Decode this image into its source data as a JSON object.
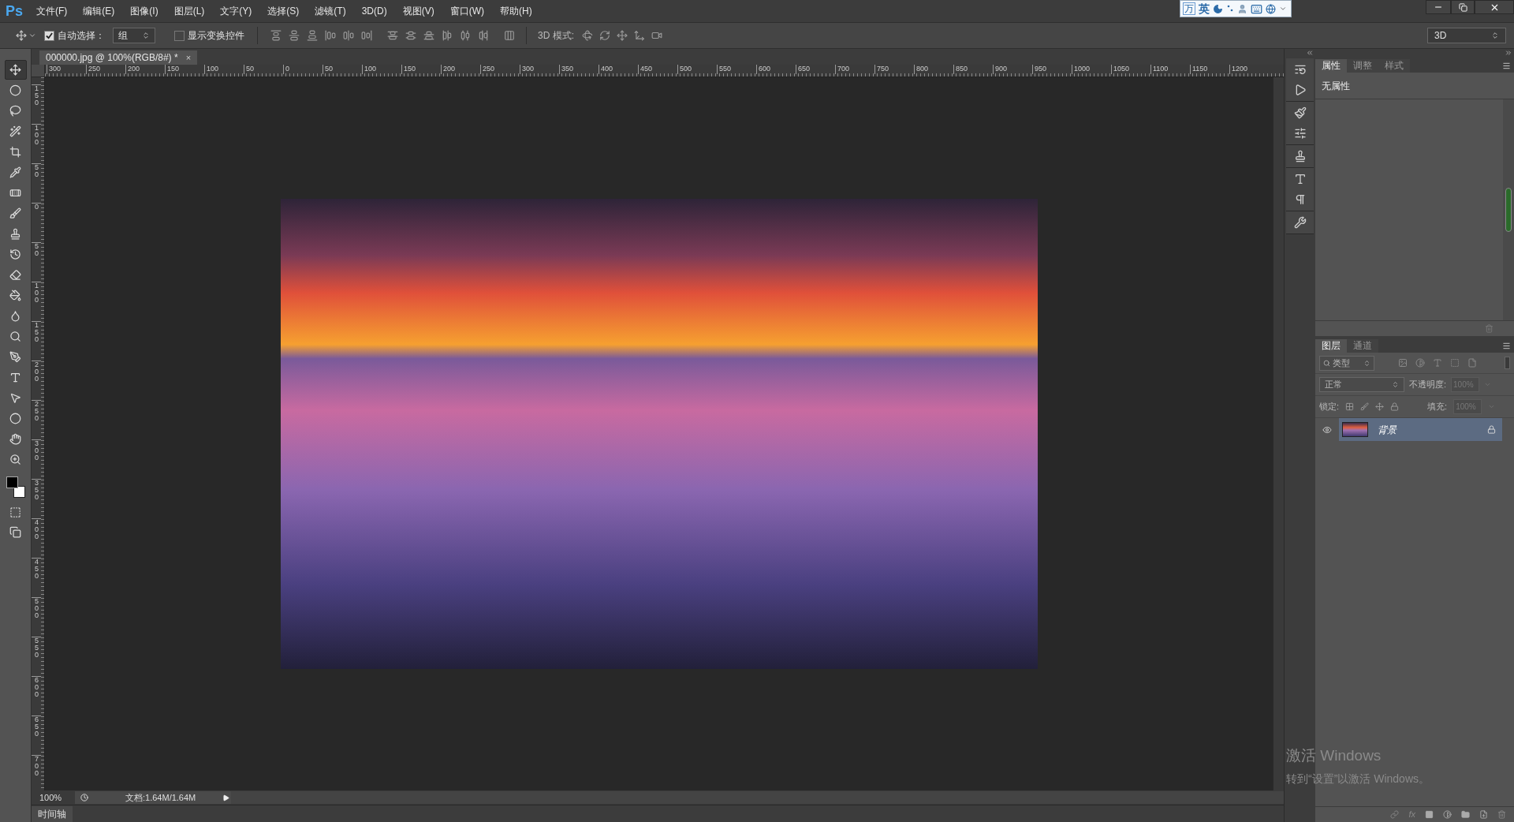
{
  "menu_bar": {
    "logo": "Ps",
    "items": [
      "文件(F)",
      "编辑(E)",
      "图像(I)",
      "图层(L)",
      "文字(Y)",
      "选择(S)",
      "滤镜(T)",
      "3D(D)",
      "视图(V)",
      "窗口(W)",
      "帮助(H)"
    ]
  },
  "ime_toolbar": {
    "logo": "万",
    "mode": "英"
  },
  "options_bar": {
    "auto_select": {
      "label": "自动选择：",
      "checked": true
    },
    "auto_select_target": "组",
    "show_transform": {
      "label": "显示变换控件",
      "checked": false
    },
    "mode_label": "3D 模式:",
    "workspace": "3D"
  },
  "tools": [
    {
      "selected": true
    },
    {
      "selected": false
    },
    {
      "selected": false
    },
    {
      "selected": false
    },
    {
      "selected": false
    },
    {
      "selected": false
    },
    {
      "selected": false
    },
    {
      "selected": false
    },
    {
      "selected": false
    },
    {
      "selected": false
    },
    {
      "selected": false
    },
    {
      "selected": false
    },
    {
      "selected": false
    },
    {
      "selected": false
    },
    {
      "selected": false
    },
    {
      "selected": false
    },
    {
      "selected": false
    },
    {
      "selected": false
    },
    {
      "selected": false
    },
    {
      "selected": false
    }
  ],
  "document_tab": {
    "title": "000000.jpg @ 100%(RGB/8#) *",
    "close": "×"
  },
  "rulers": {
    "horizontal": [
      "300",
      "250",
      "200",
      "150",
      "100",
      "50",
      "0",
      "50",
      "100",
      "150",
      "200",
      "250",
      "300",
      "350",
      "400",
      "450",
      "500",
      "550",
      "600",
      "650",
      "700",
      "750",
      "800",
      "850",
      "900",
      "950",
      "1000",
      "1050",
      "1100",
      "1150",
      "1200"
    ],
    "vertical": [
      "150",
      "100",
      "50",
      "0",
      "50",
      "100",
      "150",
      "200",
      "250",
      "300",
      "350",
      "400",
      "450",
      "500",
      "550",
      "600",
      "650",
      "700"
    ]
  },
  "status_bar": {
    "zoom": "100%",
    "document": "文档:1.64M/1.64M"
  },
  "timeline_tab": "时间轴",
  "properties_panel": {
    "tabs": [
      {
        "label": "属性",
        "selected": true
      },
      {
        "label": "调整",
        "selected": false
      },
      {
        "label": "样式",
        "selected": false
      }
    ],
    "content": "无属性"
  },
  "layers_panel": {
    "tabs": [
      {
        "label": "图层",
        "selected": true
      },
      {
        "label": "通道",
        "selected": false
      }
    ],
    "filter": "类型",
    "blend_mode": "正常",
    "opacity_label": "不透明度:",
    "opacity": "100%",
    "lock_label": "锁定:",
    "fill_label": "填充:",
    "fill": "100%",
    "layers": [
      {
        "name": "背景",
        "visible": true,
        "locked": true,
        "selected": true
      }
    ],
    "fx": "fx"
  },
  "activation_notice": {
    "title": "激活 Windows",
    "subtitle": "转到“设置”以激活 Windows。"
  }
}
